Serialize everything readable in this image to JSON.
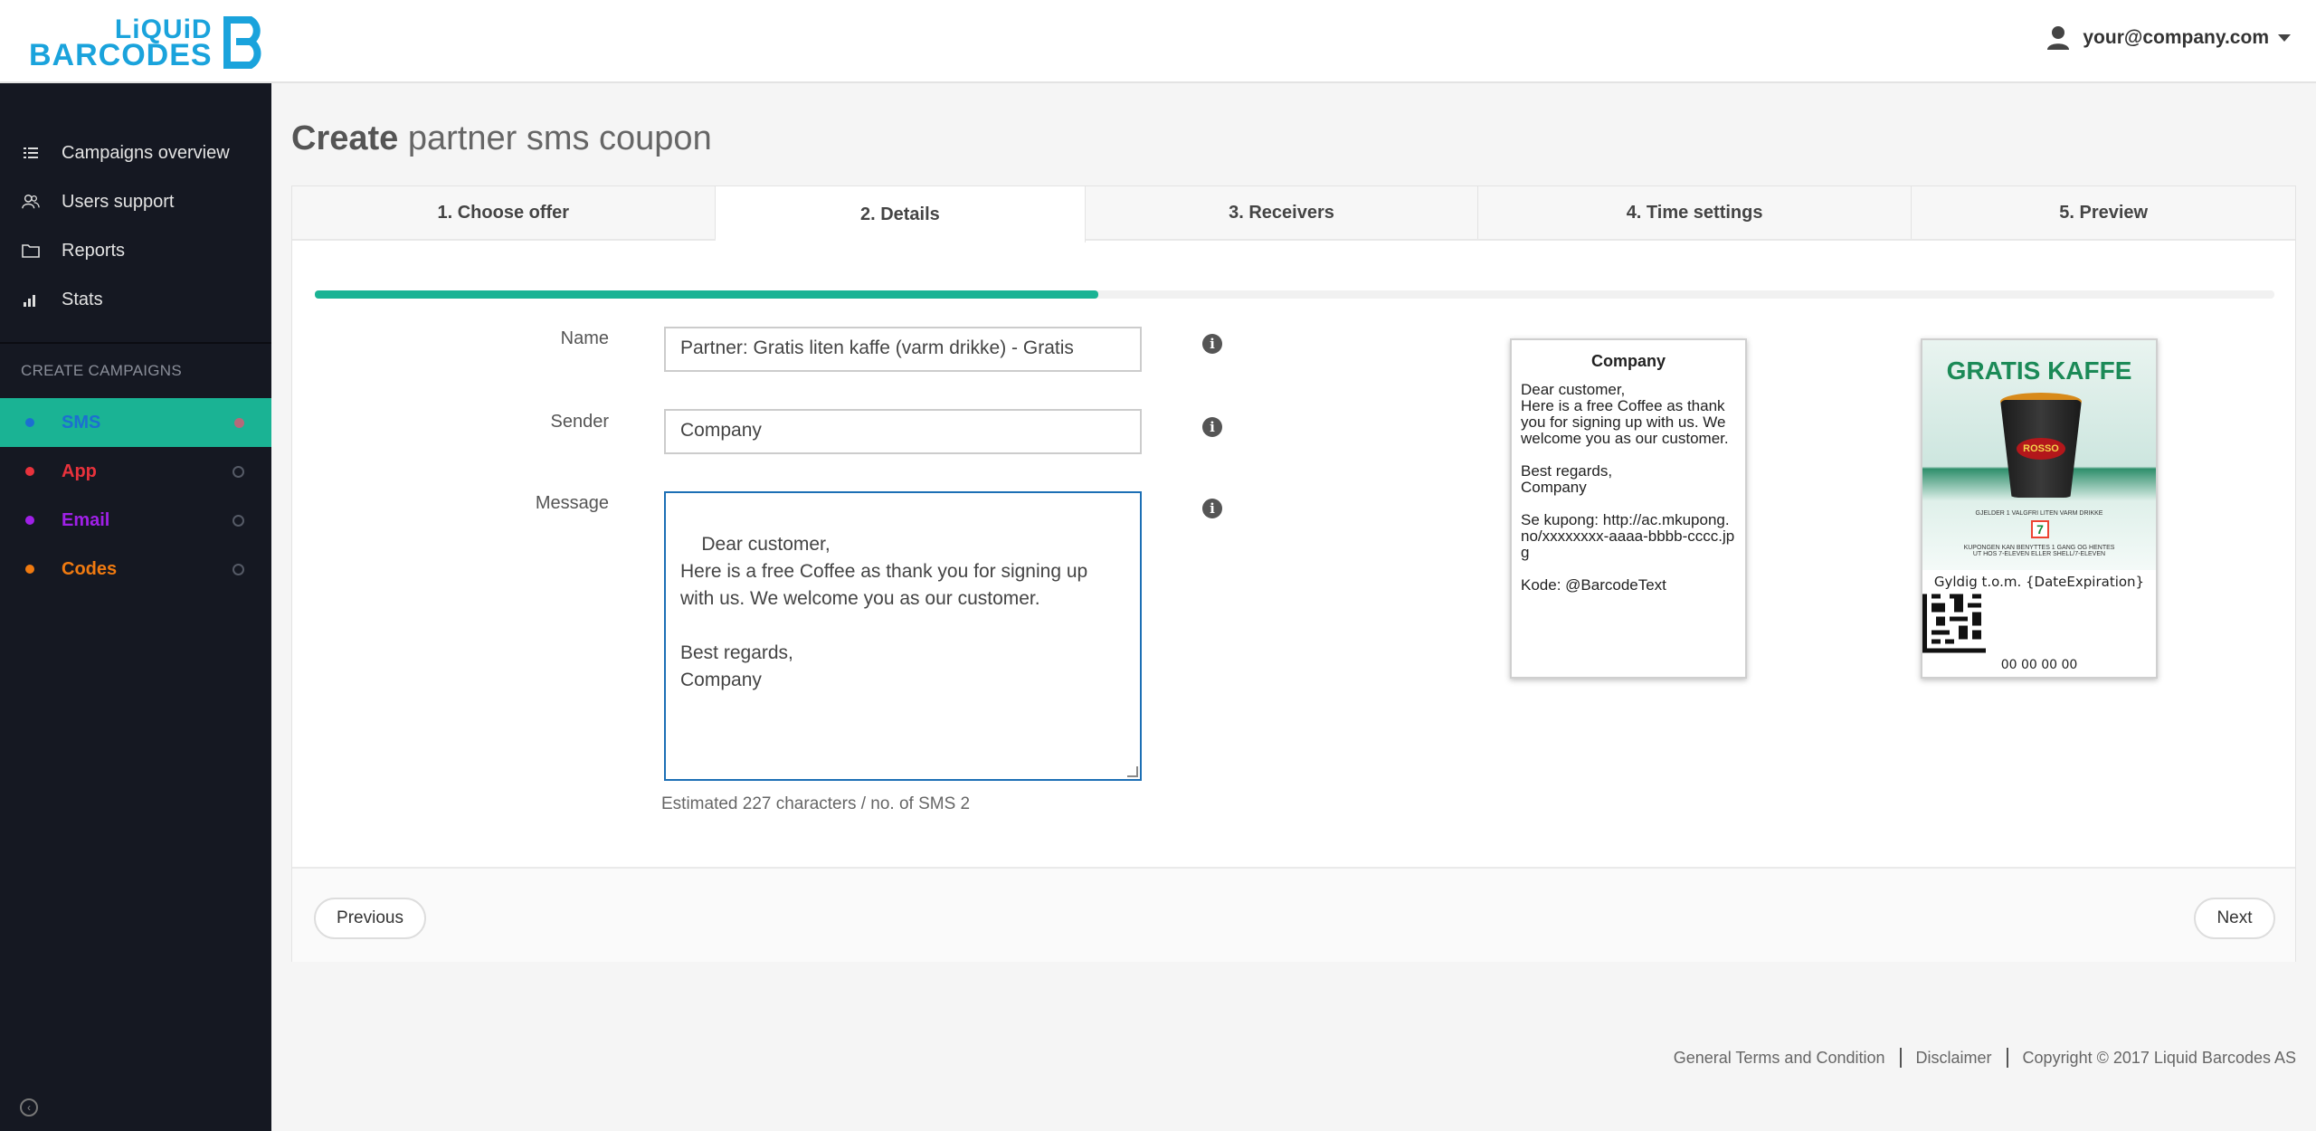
{
  "header": {
    "logo_line1": "LiQUiD",
    "logo_line2": "BARCODES",
    "user_email": "your@company.com"
  },
  "sidebar": {
    "nav": [
      {
        "label": "Campaigns overview",
        "icon": "list-icon"
      },
      {
        "label": "Users support",
        "icon": "users-icon"
      },
      {
        "label": "Reports",
        "icon": "folder-icon"
      },
      {
        "label": "Stats",
        "icon": "bar-chart-icon"
      }
    ],
    "create_heading": "CREATE CAMPAIGNS",
    "campaigns": [
      {
        "label": "SMS",
        "color": "#1c6fd1",
        "active": true
      },
      {
        "label": "App",
        "color": "#e8323c"
      },
      {
        "label": "Email",
        "color": "#a020e8"
      },
      {
        "label": "Codes",
        "color": "#f07a10"
      }
    ]
  },
  "page": {
    "title_bold": "Create",
    "title_rest": "partner sms coupon"
  },
  "tabs": [
    {
      "label": "1. Choose offer"
    },
    {
      "label": "2. Details",
      "active": true
    },
    {
      "label": "3. Receivers"
    },
    {
      "label": "4. Time settings"
    },
    {
      "label": "5. Preview"
    }
  ],
  "progress": {
    "percent": 40
  },
  "form": {
    "name_label": "Name",
    "name_value": "Partner: Gratis liten kaffe (varm drikke) - Gratis",
    "sender_label": "Sender",
    "sender_value": "Company",
    "message_label": "Message",
    "message_value": "Dear customer,\nHere is a free Coffee as thank you for signing up with us. We welcome you as our customer.\n\nBest regards,\nCompany",
    "estimate": "Estimated 227 characters / no. of SMS 2"
  },
  "sms_preview": {
    "title": "Company",
    "body": "Dear customer,\nHere is a free Coffee as thank you for signing up with us. We welcome you as our customer.\n\nBest regards,\nCompany\n\nSe kupong: http://ac.mkupong.no/xxxxxxxx-aaaa-bbbb-cccc.jpg\n\nKode: @BarcodeText"
  },
  "coupon_preview": {
    "headline": "GRATIS KAFFE",
    "cup_brand": "ROSSO",
    "small_text1": "GJELDER 1 VALGFRI LITEN VARM DRIKKE",
    "small_text2": "KUPONGEN KAN BENYTTES 1 GANG OG HENTES UT HOS 7-ELEVEN ELLER SHELL/7-ELEVEN",
    "store_mark": "7",
    "valid_text": "Gyldig t.o.m. {DateExpiration}",
    "code_number": "00 00 00 00"
  },
  "buttons": {
    "previous": "Previous",
    "next": "Next"
  },
  "footer": {
    "terms": "General Terms and Condition",
    "disclaimer": "Disclaimer",
    "copyright": "Copyright © 2017 Liquid Barcodes AS"
  }
}
